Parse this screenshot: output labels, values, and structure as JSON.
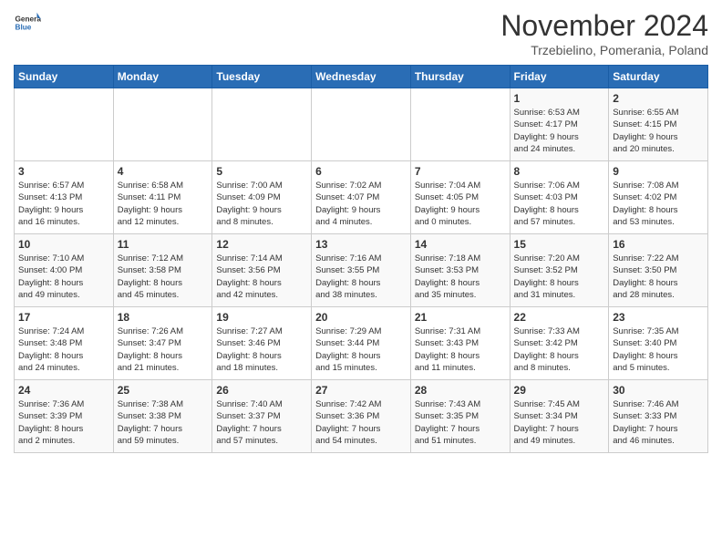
{
  "header": {
    "logo_general": "General",
    "logo_blue": "Blue",
    "title": "November 2024",
    "location": "Trzebielino, Pomerania, Poland"
  },
  "days_of_week": [
    "Sunday",
    "Monday",
    "Tuesday",
    "Wednesday",
    "Thursday",
    "Friday",
    "Saturday"
  ],
  "weeks": [
    [
      {
        "day": "",
        "info": ""
      },
      {
        "day": "",
        "info": ""
      },
      {
        "day": "",
        "info": ""
      },
      {
        "day": "",
        "info": ""
      },
      {
        "day": "",
        "info": ""
      },
      {
        "day": "1",
        "info": "Sunrise: 6:53 AM\nSunset: 4:17 PM\nDaylight: 9 hours\nand 24 minutes."
      },
      {
        "day": "2",
        "info": "Sunrise: 6:55 AM\nSunset: 4:15 PM\nDaylight: 9 hours\nand 20 minutes."
      }
    ],
    [
      {
        "day": "3",
        "info": "Sunrise: 6:57 AM\nSunset: 4:13 PM\nDaylight: 9 hours\nand 16 minutes."
      },
      {
        "day": "4",
        "info": "Sunrise: 6:58 AM\nSunset: 4:11 PM\nDaylight: 9 hours\nand 12 minutes."
      },
      {
        "day": "5",
        "info": "Sunrise: 7:00 AM\nSunset: 4:09 PM\nDaylight: 9 hours\nand 8 minutes."
      },
      {
        "day": "6",
        "info": "Sunrise: 7:02 AM\nSunset: 4:07 PM\nDaylight: 9 hours\nand 4 minutes."
      },
      {
        "day": "7",
        "info": "Sunrise: 7:04 AM\nSunset: 4:05 PM\nDaylight: 9 hours\nand 0 minutes."
      },
      {
        "day": "8",
        "info": "Sunrise: 7:06 AM\nSunset: 4:03 PM\nDaylight: 8 hours\nand 57 minutes."
      },
      {
        "day": "9",
        "info": "Sunrise: 7:08 AM\nSunset: 4:02 PM\nDaylight: 8 hours\nand 53 minutes."
      }
    ],
    [
      {
        "day": "10",
        "info": "Sunrise: 7:10 AM\nSunset: 4:00 PM\nDaylight: 8 hours\nand 49 minutes."
      },
      {
        "day": "11",
        "info": "Sunrise: 7:12 AM\nSunset: 3:58 PM\nDaylight: 8 hours\nand 45 minutes."
      },
      {
        "day": "12",
        "info": "Sunrise: 7:14 AM\nSunset: 3:56 PM\nDaylight: 8 hours\nand 42 minutes."
      },
      {
        "day": "13",
        "info": "Sunrise: 7:16 AM\nSunset: 3:55 PM\nDaylight: 8 hours\nand 38 minutes."
      },
      {
        "day": "14",
        "info": "Sunrise: 7:18 AM\nSunset: 3:53 PM\nDaylight: 8 hours\nand 35 minutes."
      },
      {
        "day": "15",
        "info": "Sunrise: 7:20 AM\nSunset: 3:52 PM\nDaylight: 8 hours\nand 31 minutes."
      },
      {
        "day": "16",
        "info": "Sunrise: 7:22 AM\nSunset: 3:50 PM\nDaylight: 8 hours\nand 28 minutes."
      }
    ],
    [
      {
        "day": "17",
        "info": "Sunrise: 7:24 AM\nSunset: 3:48 PM\nDaylight: 8 hours\nand 24 minutes."
      },
      {
        "day": "18",
        "info": "Sunrise: 7:26 AM\nSunset: 3:47 PM\nDaylight: 8 hours\nand 21 minutes."
      },
      {
        "day": "19",
        "info": "Sunrise: 7:27 AM\nSunset: 3:46 PM\nDaylight: 8 hours\nand 18 minutes."
      },
      {
        "day": "20",
        "info": "Sunrise: 7:29 AM\nSunset: 3:44 PM\nDaylight: 8 hours\nand 15 minutes."
      },
      {
        "day": "21",
        "info": "Sunrise: 7:31 AM\nSunset: 3:43 PM\nDaylight: 8 hours\nand 11 minutes."
      },
      {
        "day": "22",
        "info": "Sunrise: 7:33 AM\nSunset: 3:42 PM\nDaylight: 8 hours\nand 8 minutes."
      },
      {
        "day": "23",
        "info": "Sunrise: 7:35 AM\nSunset: 3:40 PM\nDaylight: 8 hours\nand 5 minutes."
      }
    ],
    [
      {
        "day": "24",
        "info": "Sunrise: 7:36 AM\nSunset: 3:39 PM\nDaylight: 8 hours\nand 2 minutes."
      },
      {
        "day": "25",
        "info": "Sunrise: 7:38 AM\nSunset: 3:38 PM\nDaylight: 7 hours\nand 59 minutes."
      },
      {
        "day": "26",
        "info": "Sunrise: 7:40 AM\nSunset: 3:37 PM\nDaylight: 7 hours\nand 57 minutes."
      },
      {
        "day": "27",
        "info": "Sunrise: 7:42 AM\nSunset: 3:36 PM\nDaylight: 7 hours\nand 54 minutes."
      },
      {
        "day": "28",
        "info": "Sunrise: 7:43 AM\nSunset: 3:35 PM\nDaylight: 7 hours\nand 51 minutes."
      },
      {
        "day": "29",
        "info": "Sunrise: 7:45 AM\nSunset: 3:34 PM\nDaylight: 7 hours\nand 49 minutes."
      },
      {
        "day": "30",
        "info": "Sunrise: 7:46 AM\nSunset: 3:33 PM\nDaylight: 7 hours\nand 46 minutes."
      }
    ]
  ]
}
